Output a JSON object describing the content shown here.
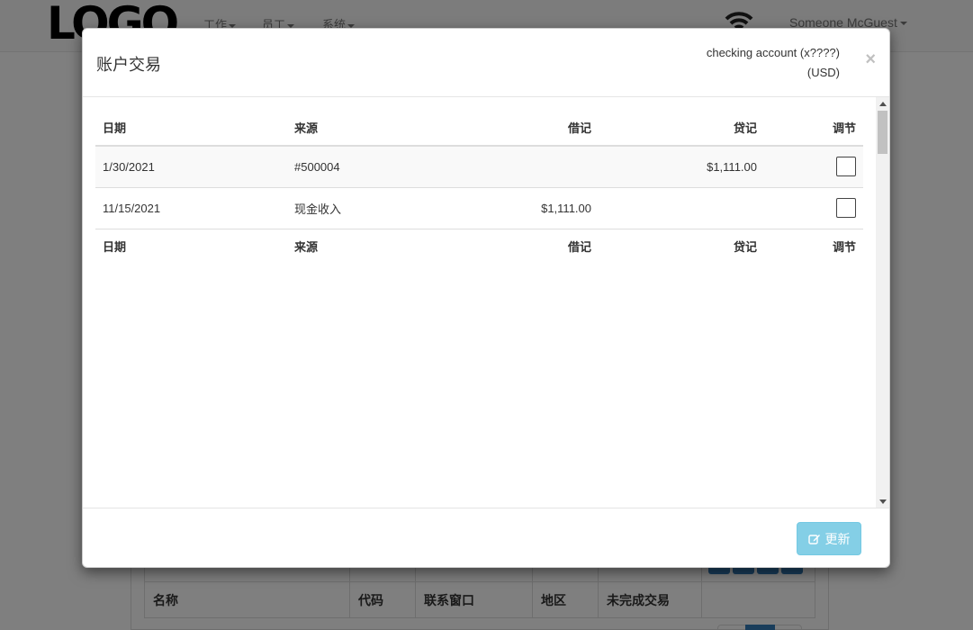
{
  "navbar": {
    "logo": "LOGO",
    "menus": [
      {
        "label": "工作"
      },
      {
        "label": "员工"
      },
      {
        "label": "系统"
      }
    ],
    "user": "Someone McGuest"
  },
  "background_table": {
    "headers": [
      "名称",
      "代码",
      "联系窗口",
      "地区",
      "未完成交易",
      ""
    ]
  },
  "modal": {
    "title": "账户交易",
    "account_line1": "checking account (x????)",
    "account_line2": "(USD)",
    "close": "×",
    "table": {
      "headers": [
        "日期",
        "来源",
        "借记",
        "贷记",
        "调节"
      ],
      "rows": [
        {
          "date": "1/30/2021",
          "source": "#500004",
          "debit": "",
          "credit": "$1,111.00",
          "reconciled": false
        },
        {
          "date": "11/15/2021",
          "source": "现金收入",
          "debit": "$1,111.00",
          "credit": "",
          "reconciled": false
        }
      ],
      "footer": [
        "日期",
        "来源",
        "借记",
        "贷记",
        "调节"
      ]
    },
    "update_button": "更新",
    "update_icon": "edit-icon"
  },
  "colors": {
    "info_button": "#5bc0de",
    "primary": "#337ab7",
    "backdrop": "rgba(0,0,0,0.5)"
  }
}
